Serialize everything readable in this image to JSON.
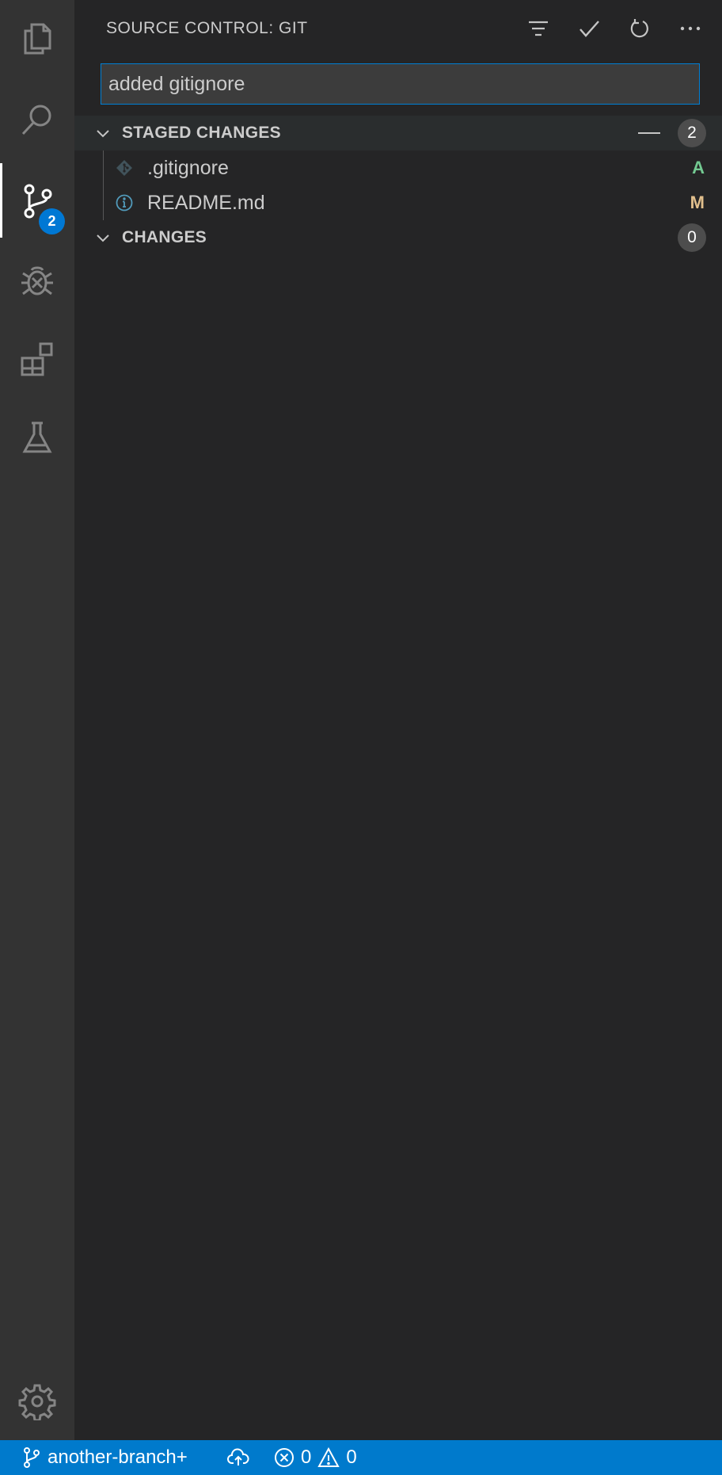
{
  "header": {
    "title": "SOURCE CONTROL: GIT"
  },
  "commit": {
    "value": "added gitignore"
  },
  "activity_bar": {
    "items": [
      "files-icon",
      "search-icon",
      "source-control-icon",
      "debug-icon",
      "extensions-icon",
      "testing-icon"
    ],
    "source_control_badge": "2",
    "settings": "gear-icon"
  },
  "staged": {
    "title": "STAGED CHANGES",
    "count": "2",
    "files": [
      {
        "name": ".gitignore",
        "status": "A",
        "status_color": "#73c991"
      },
      {
        "name": "README.md",
        "status": "M",
        "status_color": "#e2c08d"
      }
    ]
  },
  "changes": {
    "title": "CHANGES",
    "count": "0"
  },
  "status_bar": {
    "branch": "another-branch+",
    "errors": "0",
    "warnings": "0"
  },
  "colors": {
    "accent": "#007acc",
    "badge": "#0078d4"
  }
}
